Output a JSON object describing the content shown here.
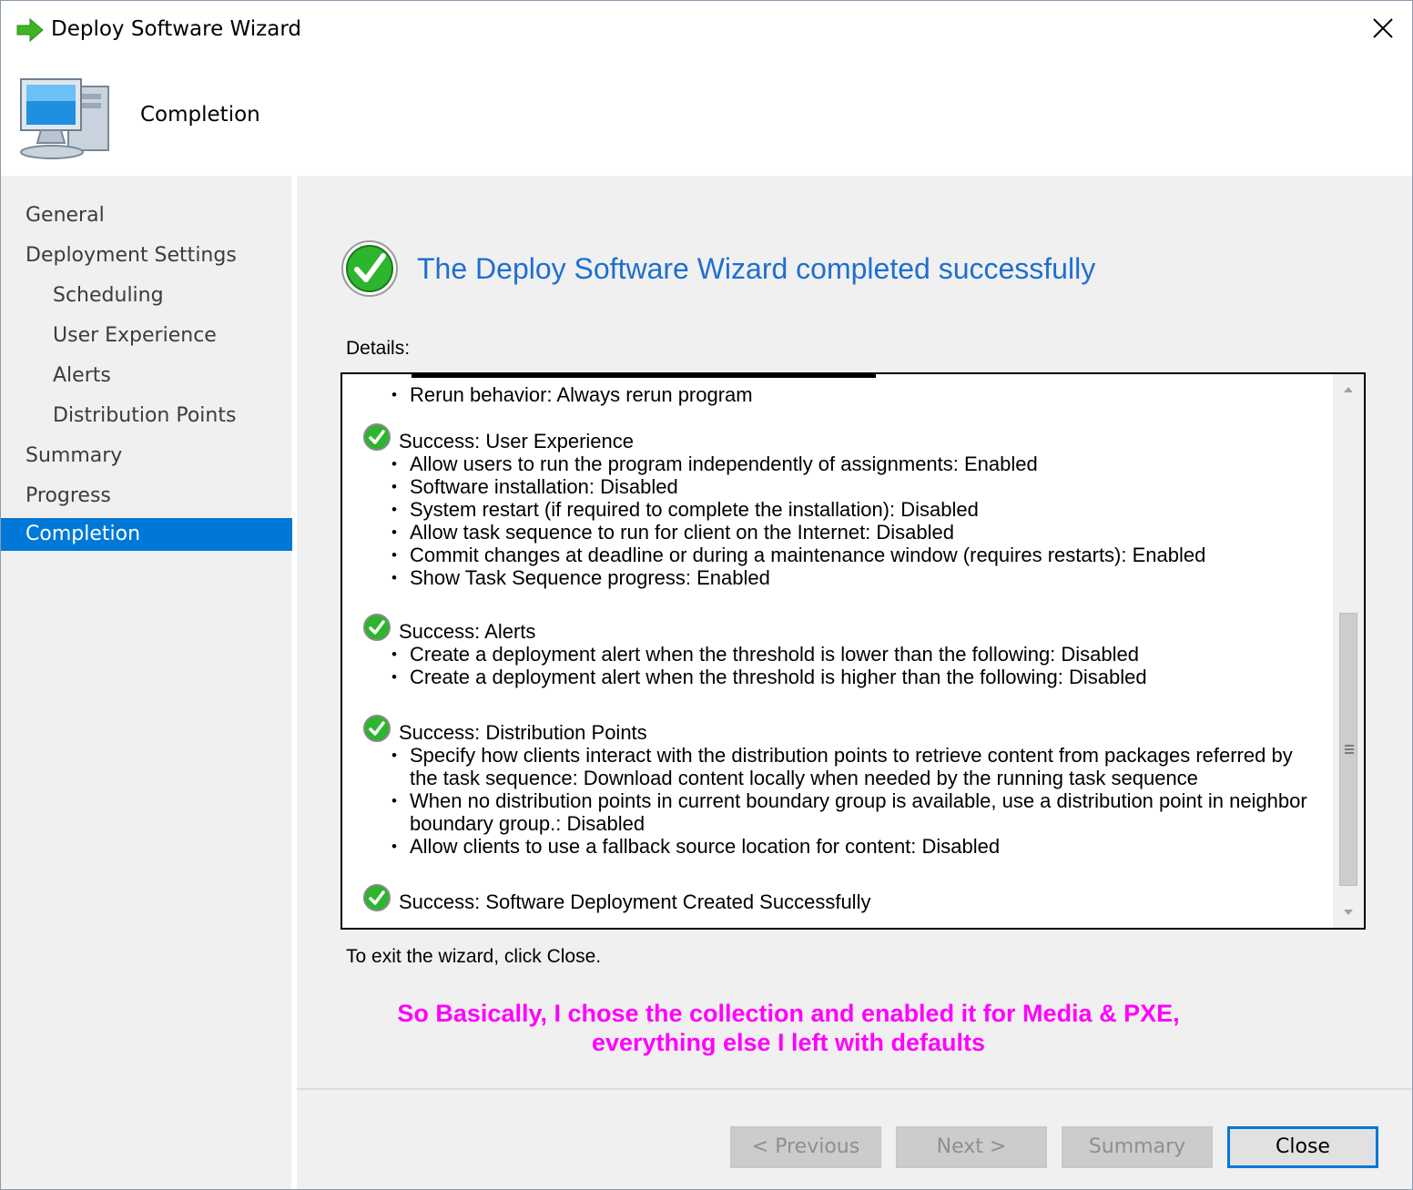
{
  "window": {
    "title": "Deploy Software Wizard",
    "header_title": "Completion"
  },
  "nav": {
    "items": [
      {
        "label": "General"
      },
      {
        "label": "Deployment Settings"
      },
      {
        "label": "Scheduling"
      },
      {
        "label": "User Experience"
      },
      {
        "label": "Alerts"
      },
      {
        "label": "Distribution Points"
      },
      {
        "label": "Summary"
      },
      {
        "label": "Progress"
      },
      {
        "label": "Completion"
      }
    ],
    "active": "Completion"
  },
  "content": {
    "heading": "The Deploy Software Wizard completed successfully",
    "details_label": "Details:",
    "exit_text": "To exit the wizard, click Close.",
    "annotation_line1": "So Basically, I chose the collection and enabled it for Media & PXE,",
    "annotation_line2": "everything else I left with defaults"
  },
  "details": {
    "first_bullet": "Rerun behavior: Always rerun program",
    "sections": [
      {
        "title": "Success: User Experience",
        "bullets": [
          "Allow users to run the program independently of assignments: Enabled",
          "Software installation: Disabled",
          "System restart (if required to complete the installation): Disabled",
          "Allow task sequence to run for client on the Internet: Disabled",
          "Commit changes at deadline or during a maintenance window (requires restarts): Enabled",
          "Show Task Sequence progress: Enabled"
        ]
      },
      {
        "title": "Success: Alerts",
        "bullets": [
          "Create a deployment alert when the threshold is lower than the following: Disabled",
          "Create a deployment alert when the threshold is higher than the following: Disabled"
        ]
      },
      {
        "title": "Success: Distribution Points",
        "bullets": [
          "Specify how clients interact with the distribution points to retrieve content from packages referred by",
          "the task sequence: Download content locally when needed by the running task sequence",
          "When no distribution points in current boundary group is available, use a distribution point in neighbor",
          "boundary group.: Disabled",
          "Allow clients to use a fallback source location for content: Disabled"
        ]
      },
      {
        "title": "Success: Software Deployment Created Successfully",
        "bullets": []
      }
    ]
  },
  "buttons": {
    "previous": "< Previous",
    "next": "Next >",
    "summary": "Summary",
    "close": "Close"
  },
  "colors": {
    "accent": "#0078d7",
    "heading_blue": "#1e6fd0",
    "annotation": "#ff00ff",
    "panel_bg": "#f0f0f0"
  }
}
